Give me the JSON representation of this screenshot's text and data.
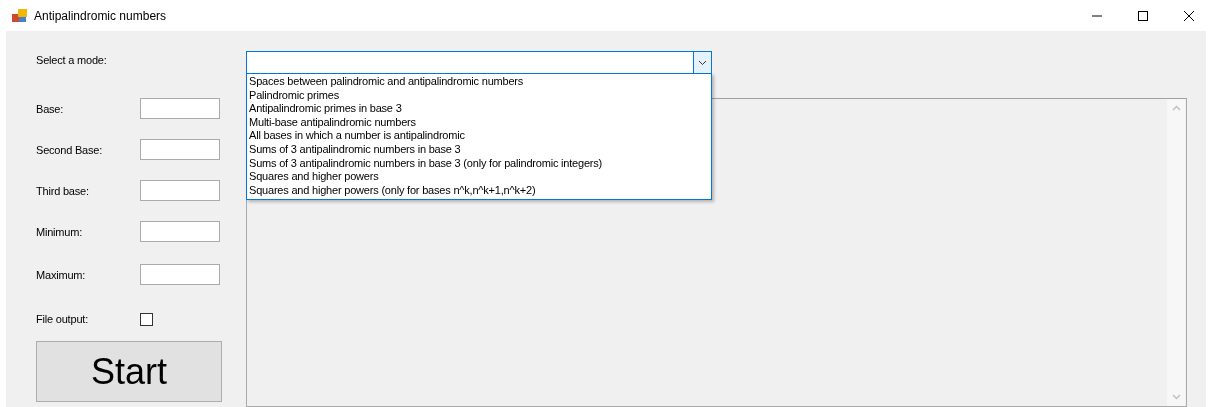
{
  "window": {
    "title": "Antipalindromic numbers"
  },
  "mode": {
    "label": "Select a mode:",
    "expanded": true,
    "options": [
      "Spaces between palindromic and antipalindromic numbers",
      "Palindromic primes",
      "Antipalindromic primes in base 3",
      "Multi-base antipalindromic numbers",
      "All bases in which a number is antipalindromic",
      "Sums of 3 antipalindromic numbers in base 3",
      "Sums of 3 antipalindromic numbers in base 3 (only for palindromic integers)",
      "Squares and higher powers",
      "Squares and higher powers (only for bases n^k,n^k+1,n^k+2)"
    ]
  },
  "fields": [
    {
      "kind": "text",
      "label": "Base:"
    },
    {
      "kind": "text",
      "label": "Second Base:"
    },
    {
      "kind": "text",
      "label": "Third base:"
    },
    {
      "kind": "text",
      "label": "Minimum:"
    },
    {
      "kind": "text",
      "label": "Maximum:"
    },
    {
      "kind": "checkbox",
      "label": "File output:",
      "checked": false
    }
  ],
  "start_button": "Start"
}
